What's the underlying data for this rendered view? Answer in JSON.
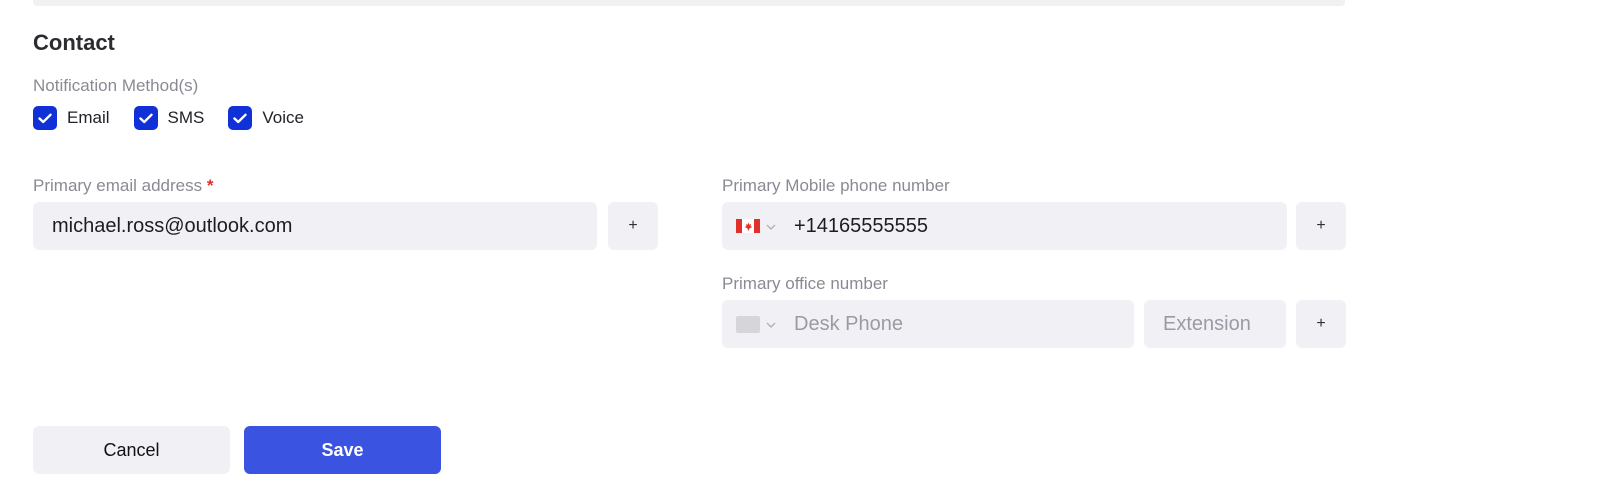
{
  "section": {
    "title": "Contact"
  },
  "notification": {
    "label": "Notification Method(s)",
    "options": [
      {
        "label": "Email",
        "checked": true
      },
      {
        "label": "SMS",
        "checked": true
      },
      {
        "label": "Voice",
        "checked": true
      }
    ]
  },
  "email": {
    "label": "Primary email address",
    "required_mark": "*",
    "value": "michael.ross@outlook.com",
    "add_label": "+"
  },
  "mobile": {
    "label": "Primary Mobile phone number",
    "country_flag": "canada-flag-icon",
    "value": "+14165555555",
    "add_label": "+"
  },
  "office": {
    "label": "Primary office number",
    "phone_placeholder": "Desk Phone",
    "extension_placeholder": "Extension",
    "add_label": "+"
  },
  "actions": {
    "cancel_label": "Cancel",
    "save_label": "Save"
  },
  "colors": {
    "checkbox": "#1030d8",
    "primary_button": "#3a53e0",
    "required": "#e0302a",
    "field_bg": "#f1f1f5"
  }
}
